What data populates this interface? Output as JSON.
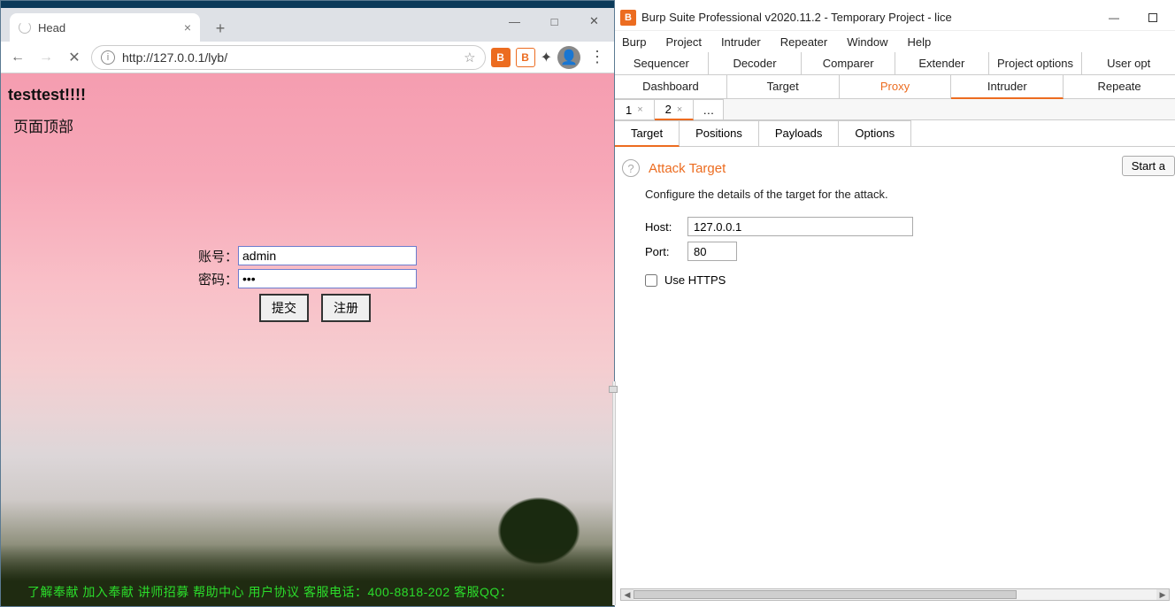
{
  "browser": {
    "tab_title": "Head",
    "url": "http://127.0.0.1/lyb/",
    "win_min": "—",
    "win_max": "□",
    "win_close": "✕",
    "page": {
      "text1": "testtest!!!!",
      "text2": "页面顶部",
      "label_user": "账号：",
      "label_pass": "密码：",
      "value_user": "admin",
      "value_pass": "•••",
      "btn_submit": "提交",
      "btn_register": "注册",
      "footer": "了解奉献 加入奉献 讲师招募 帮助中心 用户协议 客服电话：400-8818-202 客服QQ："
    }
  },
  "burp": {
    "title": "Burp Suite Professional v2020.11.2 - Temporary Project - lice",
    "menu": [
      "Burp",
      "Project",
      "Intruder",
      "Repeater",
      "Window",
      "Help"
    ],
    "tabs_row1": [
      "Sequencer",
      "Decoder",
      "Comparer",
      "Extender",
      "Project options",
      "User opt"
    ],
    "tabs_row2": [
      "Dashboard",
      "Target",
      "Proxy",
      "Intruder",
      "Repeate"
    ],
    "tabs_row2_orange_index": 2,
    "tabs_row2_active_index": 3,
    "num_tabs": [
      "1",
      "2"
    ],
    "num_active_index": 1,
    "subtabs": [
      "Target",
      "Positions",
      "Payloads",
      "Options"
    ],
    "subtab_active_index": 0,
    "section_title": "Attack Target",
    "section_desc": "Configure the details of the target for the attack.",
    "start_btn": "Start a",
    "host_label": "Host:",
    "host_value": "127.0.0.1",
    "port_label": "Port:",
    "port_value": "80",
    "https_label": "Use HTTPS"
  }
}
